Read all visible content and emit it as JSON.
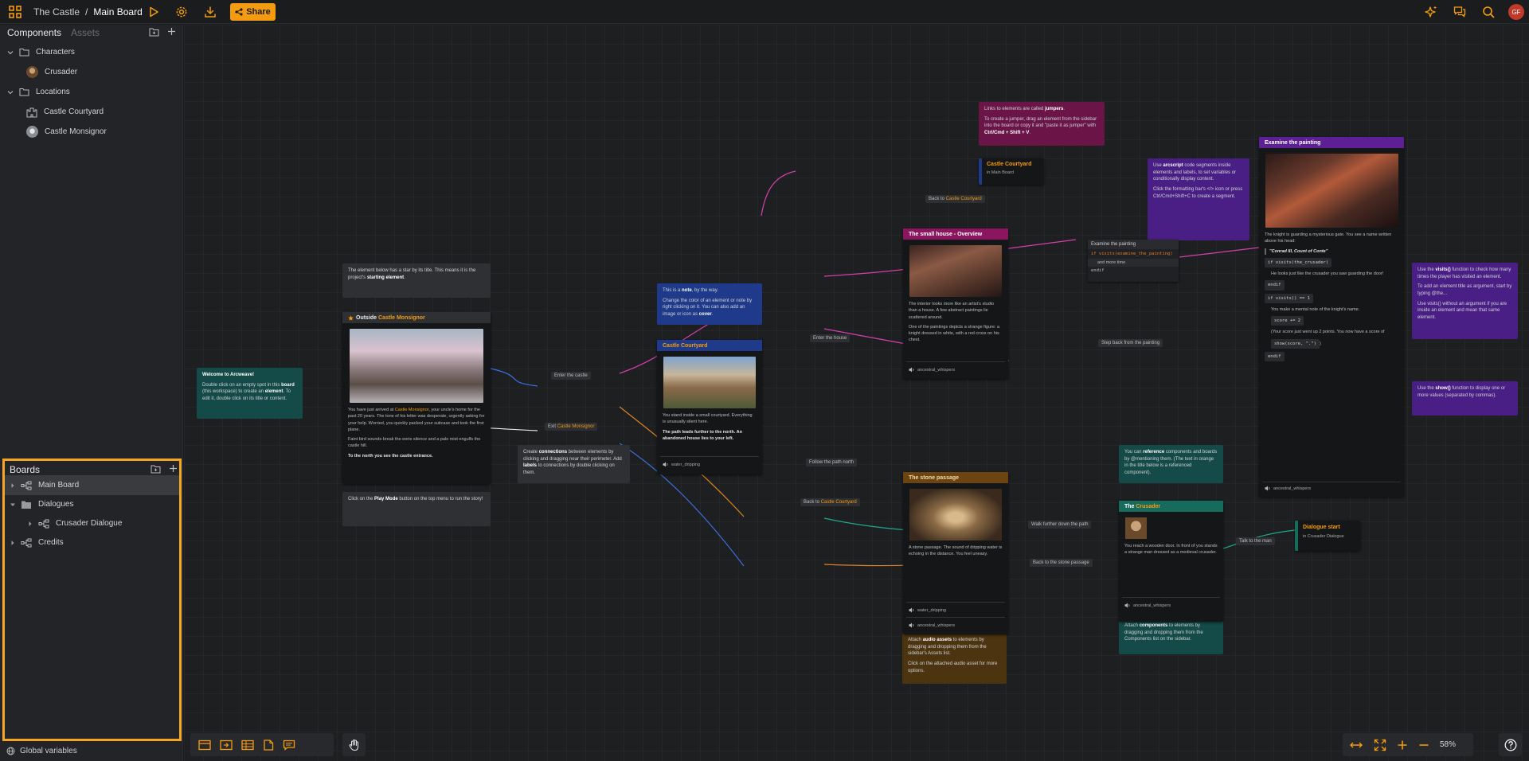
{
  "topbar": {
    "project": "The Castle",
    "separator": "/",
    "board": "Main Board",
    "share_label": "Share",
    "avatar_initials": "GF"
  },
  "sidebar": {
    "tab_components": "Components",
    "tab_assets": "Assets",
    "items": [
      {
        "label": "Characters"
      },
      {
        "label": "Crusader"
      },
      {
        "label": "Locations"
      },
      {
        "label": "Castle Courtyard"
      },
      {
        "label": "Castle Monsignor"
      }
    ]
  },
  "boards": {
    "title": "Boards",
    "items": [
      {
        "label": "Main Board"
      },
      {
        "label": "Dialogues"
      },
      {
        "label": "Crusader Dialogue"
      },
      {
        "label": "Credits"
      }
    ]
  },
  "global_variables": "Global variables",
  "zoom": "58%",
  "accent_color": "#f39c12",
  "canvas": {
    "welcome_note": {
      "title": "Welcome to Arcweave!",
      "body_1": "Double click on an empty spot in this",
      "body_2": "board",
      "body_3": "(this workspace) to create an",
      "body_4": "element",
      "body_5": ". To edit it, double click on its title or content."
    },
    "start_note": {
      "t1": "The element below has a star by its title. This means it is the project's",
      "t2": "starting element",
      "t3": "."
    },
    "play_note": {
      "t1": "Click on the",
      "t2": "Play Mode",
      "t3": "button on the top menu to run the story!"
    },
    "note_note": {
      "p1a": "This is a",
      "p1b": "note",
      "p1c": ", by the way.",
      "p2a": "Change the color of an element or note by right clicking on it. You can also add an image or icon as",
      "p2b": "cover",
      "p2c": "."
    },
    "connections_note": {
      "t1": "Create",
      "t2": "connections",
      "t3": "between elements by clicking and dragging near their perimeter. Add",
      "t4": "labels",
      "t5": "to connections by double clicking on them."
    },
    "jumpers_note": {
      "p1a": "Links to elements are called",
      "p1b": "jumpers",
      "p1c": ".",
      "p2a": "To create a jumper, drag an element from the sidebar into the board or copy it and \"paste it as jumper\" with",
      "p2b": "Ctrl/Cmd + Shift + V",
      "p2c": "."
    },
    "arcscript_note": {
      "p1a": "Use",
      "p1b": "arcscript",
      "p1c": "code segments inside elements and labels, to set variables or conditionally display content.",
      "p2": "Click the formatting bar's </> icon or press Ctrl/Cmd+Shift+C to create a segment."
    },
    "visits_note": {
      "p1a": "Use the",
      "p1b": "visits()",
      "p1c": "function to check how many times the player has visited an element.",
      "p2": "To add an element title as argument, start by typing @the...",
      "p3": "Use visits() without an argument if you are inside an element and mean that same element."
    },
    "show_note": {
      "t1": "Use the",
      "t2": "show()",
      "t3": "function to display one or more values (separated by commas)."
    },
    "references_note": {
      "t1": "You can",
      "t2": "reference",
      "t3": "components and boards by @mentioning them. (The text in orange in the title below is a referenced component)."
    },
    "components_note": {
      "t1": "Attach",
      "t2": "components",
      "t3": "to elements by dragging and dropping them from the Components list on the sidebar."
    },
    "audio_note": {
      "p1a": "Attach",
      "p1b": "audio assets",
      "p1c": "to elements by dragging and dropping them from the sidebar's Assets list.",
      "p2": "Click on the attached audio asset for more options."
    },
    "outside": {
      "title_pre": "Outside",
      "title_ref": "Castle Monsignor",
      "p1a": "You have just arrived at",
      "p1b": "Castle Monsignor",
      "p1c": ", your uncle's home for the past 20 years. The tone of his letter was desperate, urgently asking for your help. Worried, you quickly packed your suitcase and took the first plane.",
      "p2": "Faint bird sounds break the eerie silence and a pale mist engulfs the castle hill.",
      "p3": "To the north you see the castle entrance."
    },
    "courtyard": {
      "title": "Castle Courtyard",
      "p1": "You stand inside a small courtyard. Everything is unusually silent here.",
      "p2": "The path leads further to the north. An abandoned house lies to your left.",
      "audio": "water_dripping"
    },
    "smallhouse": {
      "title": "The small house - Overview",
      "p1": "The interior looks more like an artist's studio than a house. A few abstract paintings lie scattered around.",
      "p2": "One of the paintings depicts a strange figure: a knight dressed in white, with a red cross on his chest.",
      "audio": "ancestral_whispers"
    },
    "stone": {
      "title": "The stone passage",
      "p1": "A stone passage. The sound of dripping water is echoing in the distance. You feel uneasy.",
      "audio1": "water_dripping",
      "audio2": "ancestral_whispers"
    },
    "crusader": {
      "title_pre": "The",
      "title_ref": "Crusader",
      "p1": "You reach a wooden door. In front of you stands a strange man dressed as a medieval crusader.",
      "audio": "ancestral_whispers"
    },
    "painting": {
      "title": "Examine the painting",
      "p1": "The knight is guarding a mysterious gate. You see a name written above his head:",
      "quote": "\"Conrad III, Count of Conte\"",
      "if1": "if visits(the_crusader)",
      "p2": "He looks just like the crusader you saw guarding the door!",
      "endif": "endif",
      "if2": "if visits() == 1",
      "p3": "You make a mental note of the knight's name.",
      "score": "score += 2",
      "p4": "(Your score just went up 2 points. You now have a score of",
      "show": "show(score, \".\")",
      "p5": ")",
      "endif2": "endif",
      "audio": "ancestral_whispers"
    },
    "jumper_courtyard": {
      "title": "Castle Courtyard",
      "sub": "in Main Board"
    },
    "jumper_dialogue": {
      "title": "Dialogue start",
      "sub": "in Crusader Dialogue"
    },
    "branch": {
      "title": "Examine the painting",
      "row1": "if visits(examine_the_painting)",
      "row2": "and more time",
      "row3": "endif"
    },
    "labels": {
      "enter_castle": "Enter the castle",
      "exit_pre": "Exit",
      "exit_ref": "Castle Monsignor",
      "enter_house": "Enter the house",
      "back_pre": "Back to",
      "back_ref": "Castle Courtyard",
      "step_back": "Step back from the painting",
      "follow": "Follow the path north",
      "back2_pre": "Back to",
      "back2_ref": "Castle Courtyard",
      "walk": "Walk further down the path",
      "back_stone": "Back to the stone passage",
      "talk": "Talk to the man"
    }
  }
}
